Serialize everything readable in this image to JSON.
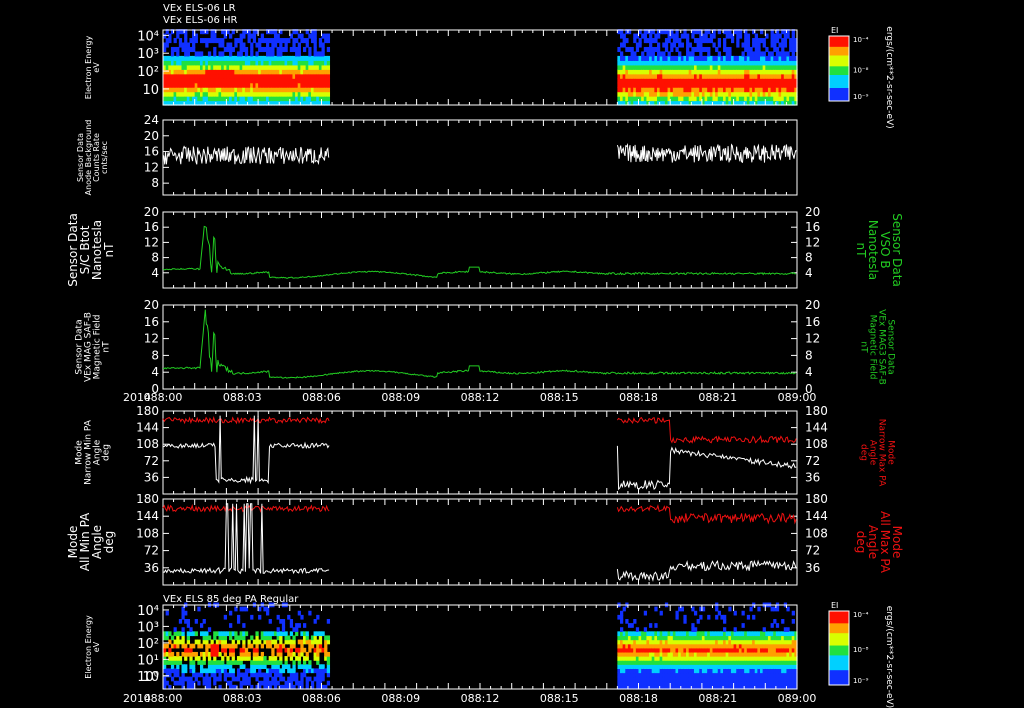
{
  "header": {
    "title_lines": [
      "VEx ELS-06 LR",
      "VEx ELS-06 HR"
    ]
  },
  "x_axis": {
    "year": "2014",
    "ticks": [
      "088:00",
      "088:03",
      "088:06",
      "088:09",
      "088:12",
      "088:15",
      "088:18",
      "088:21",
      "089:00"
    ]
  },
  "colors": {
    "white": "#ffffff",
    "green": "#22cc22",
    "red": "#ee1111",
    "bg": "#000000"
  },
  "chart_data": [
    {
      "id": "spec1",
      "type": "heatmap",
      "ylabel": [
        "Electron Energy",
        "eV"
      ],
      "yticks": [
        {
          "v": 10,
          "label": "10"
        },
        {
          "v": 100,
          "label": "10²"
        },
        {
          "v": 1000,
          "label": "10³"
        },
        {
          "v": 10000,
          "label": "10⁴"
        }
      ],
      "ylim_log": [
        0.1,
        4.3
      ],
      "data_intervals_min": [
        [
          0,
          6.3
        ],
        [
          17.2,
          24
        ]
      ],
      "colorbar": {
        "title": "EI",
        "ticks": [
          "10⁻⁴",
          "10⁻⁸",
          "10⁻⁹"
        ],
        "unit": "ergs/(cm**2-sr-sec-eV)"
      }
    },
    {
      "id": "bg",
      "type": "line",
      "ylabel": [
        "Sensor Data",
        "Anode Background",
        "Counts Rate",
        "cnts/sec"
      ],
      "yticks": [
        8,
        12,
        16,
        20,
        24
      ],
      "ylim": [
        5,
        24
      ],
      "baseline": 15,
      "amplitude": 2,
      "data_intervals_min": [
        [
          0,
          6.3
        ],
        [
          17.2,
          24
        ]
      ]
    },
    {
      "id": "bmag1",
      "type": "line",
      "ylabel_left": [
        "Sensor Data",
        "S/C Btot",
        "Nanotesla",
        "nT"
      ],
      "ylabel_right": [
        "Sensor Data",
        "VSO B",
        "Nanotesla",
        "nT"
      ],
      "yticks": [
        4,
        8,
        12,
        16,
        20
      ],
      "ylim": [
        0,
        20
      ]
    },
    {
      "id": "bmag2",
      "type": "line",
      "ylabel_left": [
        "Sensor Data",
        "VEx MAG SAF-B",
        "Magnetic Field",
        "nT"
      ],
      "ylabel_right": [
        "Sensor Data",
        "VEx MAG3 SAF-B",
        "Magnetic Field",
        "nT"
      ],
      "yticks": [
        0,
        4,
        8,
        12,
        16,
        20
      ],
      "ylim": [
        0,
        20
      ]
    },
    {
      "id": "pa1",
      "type": "line",
      "ylabel_left": [
        "Mode",
        "Narrow Min PA",
        "Angle",
        "deg"
      ],
      "ylabel_right": [
        "Mode",
        "Narrow Max PA",
        "Angle",
        "deg"
      ],
      "yticks": [
        36,
        72,
        108,
        144,
        180
      ],
      "ylim": [
        0,
        180
      ],
      "data_intervals_min": [
        [
          0,
          6.3
        ],
        [
          17.2,
          24
        ]
      ]
    },
    {
      "id": "pa2",
      "type": "line",
      "ylabel_left": [
        "Mode",
        "All Min PA",
        "Angle",
        "deg"
      ],
      "ylabel_right": [
        "Mode",
        "All Max PA",
        "Angle",
        "deg"
      ],
      "yticks": [
        36,
        72,
        108,
        144,
        180
      ],
      "ylim": [
        0,
        180
      ],
      "data_intervals_min": [
        [
          0,
          6.3
        ],
        [
          17.2,
          24
        ]
      ]
    },
    {
      "id": "spec2",
      "type": "heatmap",
      "title": "VEx ELS 85 deg PA Regular",
      "ylabel": [
        "Electron Energy",
        "eV"
      ],
      "yticks": [
        {
          "v": 1,
          "label": "10"
        },
        {
          "v": 1,
          "label": "10⁰"
        },
        {
          "v": 10,
          "label": "10¹"
        },
        {
          "v": 100,
          "label": "10²"
        },
        {
          "v": 1000,
          "label": "10³"
        },
        {
          "v": 10000,
          "label": "10⁴"
        }
      ],
      "ylim_log": [
        -0.8,
        4.3
      ],
      "data_intervals_min": [
        [
          0,
          6.3
        ],
        [
          17.2,
          24
        ]
      ],
      "colorbar": {
        "title": "EI",
        "ticks": [
          "10⁻⁴",
          "10⁻⁸",
          "10⁻⁹"
        ],
        "unit": "ergs/(cm**2-sr-sec-eV)"
      }
    }
  ]
}
